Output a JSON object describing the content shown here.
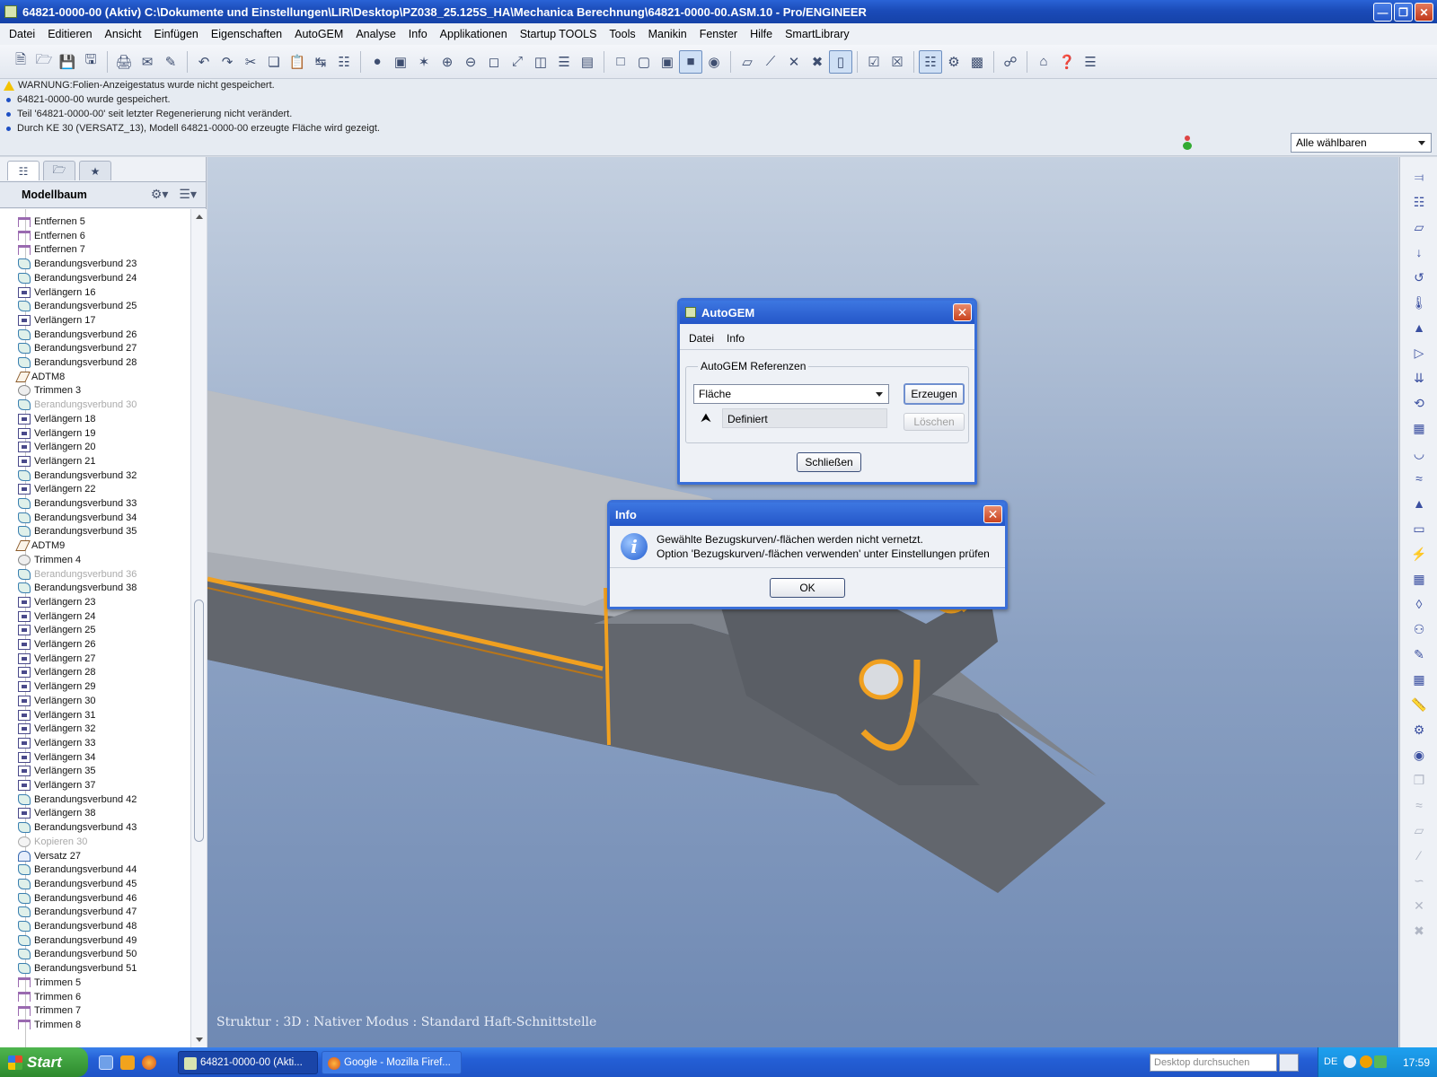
{
  "window": {
    "title": "64821-0000-00 (Aktiv) C:\\Dokumente und Einstellungen\\LIR\\Desktop\\PZ038_25.125S_HA\\Mechanica Berechnung\\64821-0000-00.ASM.10 - Pro/ENGINEER"
  },
  "menu": [
    "Datei",
    "Editieren",
    "Ansicht",
    "Einfügen",
    "Eigenschaften",
    "AutoGEM",
    "Analyse",
    "Info",
    "Applikationen",
    "Startup TOOLS",
    "Tools",
    "Manikin",
    "Fenster",
    "Hilfe",
    "SmartLibrary"
  ],
  "messages": [
    "WARNUNG:Folien-Anzeigestatus wurde nicht gespeichert.",
    "64821-0000-00 wurde gespeichert.",
    "Teil '64821-0000-00' seit letzter Regenerierung nicht verändert.",
    "Durch KE 30 (VERSATZ_13), Modell 64821-0000-00 erzeugte Fläche wird gezeigt."
  ],
  "selection_filter": "Alle wählbaren",
  "model_tree": {
    "title": "Modellbaum",
    "items": [
      {
        "label": "Entfernen 5",
        "icon": "remove",
        "dim": false
      },
      {
        "label": "Entfernen 6",
        "icon": "remove",
        "dim": false
      },
      {
        "label": "Entfernen 7",
        "icon": "remove",
        "dim": false
      },
      {
        "label": "Berandungsverbund 23",
        "icon": "boundary",
        "dim": false
      },
      {
        "label": "Berandungsverbund 24",
        "icon": "boundary",
        "dim": false
      },
      {
        "label": "Verlängern 16",
        "icon": "extend",
        "dim": false
      },
      {
        "label": "Berandungsverbund 25",
        "icon": "boundary",
        "dim": false
      },
      {
        "label": "Verlängern 17",
        "icon": "extend",
        "dim": false
      },
      {
        "label": "Berandungsverbund 26",
        "icon": "boundary",
        "dim": false
      },
      {
        "label": "Berandungsverbund 27",
        "icon": "boundary",
        "dim": false
      },
      {
        "label": "Berandungsverbund 28",
        "icon": "boundary",
        "dim": false
      },
      {
        "label": "ADTM8",
        "icon": "datum",
        "dim": false
      },
      {
        "label": "Trimmen 3",
        "icon": "trim",
        "dim": false
      },
      {
        "label": "Berandungsverbund 30",
        "icon": "boundary",
        "dim": true
      },
      {
        "label": "Verlängern 18",
        "icon": "extend",
        "dim": false
      },
      {
        "label": "Verlängern 19",
        "icon": "extend",
        "dim": false
      },
      {
        "label": "Verlängern 20",
        "icon": "extend",
        "dim": false
      },
      {
        "label": "Verlängern 21",
        "icon": "extend",
        "dim": false
      },
      {
        "label": "Berandungsverbund 32",
        "icon": "boundary",
        "dim": false
      },
      {
        "label": "Verlängern 22",
        "icon": "extend",
        "dim": false
      },
      {
        "label": "Berandungsverbund 33",
        "icon": "boundary",
        "dim": false
      },
      {
        "label": "Berandungsverbund 34",
        "icon": "boundary",
        "dim": false
      },
      {
        "label": "Berandungsverbund 35",
        "icon": "boundary",
        "dim": false
      },
      {
        "label": "ADTM9",
        "icon": "datum",
        "dim": false
      },
      {
        "label": "Trimmen 4",
        "icon": "trim",
        "dim": false
      },
      {
        "label": "Berandungsverbund 36",
        "icon": "boundary",
        "dim": true
      },
      {
        "label": "Berandungsverbund 38",
        "icon": "boundary",
        "dim": false
      },
      {
        "label": "Verlängern 23",
        "icon": "extend",
        "dim": false
      },
      {
        "label": "Verlängern 24",
        "icon": "extend",
        "dim": false
      },
      {
        "label": "Verlängern 25",
        "icon": "extend",
        "dim": false
      },
      {
        "label": "Verlängern 26",
        "icon": "extend",
        "dim": false
      },
      {
        "label": "Verlängern 27",
        "icon": "extend",
        "dim": false
      },
      {
        "label": "Verlängern 28",
        "icon": "extend",
        "dim": false
      },
      {
        "label": "Verlängern 29",
        "icon": "extend",
        "dim": false
      },
      {
        "label": "Verlängern 30",
        "icon": "extend",
        "dim": false
      },
      {
        "label": "Verlängern 31",
        "icon": "extend",
        "dim": false
      },
      {
        "label": "Verlängern 32",
        "icon": "extend",
        "dim": false
      },
      {
        "label": "Verlängern 33",
        "icon": "extend",
        "dim": false
      },
      {
        "label": "Verlängern 34",
        "icon": "extend",
        "dim": false
      },
      {
        "label": "Verlängern 35",
        "icon": "extend",
        "dim": false
      },
      {
        "label": "Verlängern 37",
        "icon": "extend",
        "dim": false
      },
      {
        "label": "Berandungsverbund 42",
        "icon": "boundary",
        "dim": false
      },
      {
        "label": "Verlängern 38",
        "icon": "extend",
        "dim": false
      },
      {
        "label": "Berandungsverbund 43",
        "icon": "boundary",
        "dim": false
      },
      {
        "label": "Kopieren 30",
        "icon": "copy",
        "dim": true
      },
      {
        "label": "Versatz 27",
        "icon": "offset",
        "dim": false
      },
      {
        "label": "Berandungsverbund 44",
        "icon": "boundary",
        "dim": false
      },
      {
        "label": "Berandungsverbund 45",
        "icon": "boundary",
        "dim": false
      },
      {
        "label": "Berandungsverbund 46",
        "icon": "boundary",
        "dim": false
      },
      {
        "label": "Berandungsverbund 47",
        "icon": "boundary",
        "dim": false
      },
      {
        "label": "Berandungsverbund 48",
        "icon": "boundary",
        "dim": false
      },
      {
        "label": "Berandungsverbund 49",
        "icon": "boundary",
        "dim": false
      },
      {
        "label": "Berandungsverbund 50",
        "icon": "boundary",
        "dim": false
      },
      {
        "label": "Berandungsverbund 51",
        "icon": "boundary",
        "dim": false
      },
      {
        "label": "Trimmen 5",
        "icon": "remove",
        "dim": false
      },
      {
        "label": "Trimmen 6",
        "icon": "remove",
        "dim": false
      },
      {
        "label": "Trimmen 7",
        "icon": "remove",
        "dim": false
      },
      {
        "label": "Trimmen 8",
        "icon": "remove",
        "dim": false
      }
    ]
  },
  "viewport": {
    "status": "Struktur : 3D : Nativer Modus : Standard Haft-Schnittstelle"
  },
  "autogem_dialog": {
    "title": "AutoGEM",
    "menu": [
      "Datei",
      "Info"
    ],
    "group_label": "AutoGEM Referenzen",
    "type_select": "Fläche",
    "list_item": "Definiert",
    "create_button": "Erzeugen",
    "delete_button": "Löschen",
    "close_button": "Schließen"
  },
  "info_dialog": {
    "title": "Info",
    "line1": "Gewählte Bezugskurven/-flächen werden nicht vernetzt.",
    "line2": "Option 'Bezugskurven/-flächen verwenden' unter Einstellungen prüfen",
    "ok_button": "OK"
  },
  "taskbar": {
    "start": "Start",
    "tasks": [
      "64821-0000-00 (Akti...",
      "Google - Mozilla Firef..."
    ],
    "search_placeholder": "Desktop durchsuchen",
    "language": "DE",
    "clock": "17:59"
  },
  "colors": {
    "title_blue": "#1b4bb8",
    "viewport_top": "#c4d0e0",
    "viewport_bottom": "#6f89b3",
    "model_edge_orange": "#f0a020",
    "model_gray": "#5d6168"
  }
}
